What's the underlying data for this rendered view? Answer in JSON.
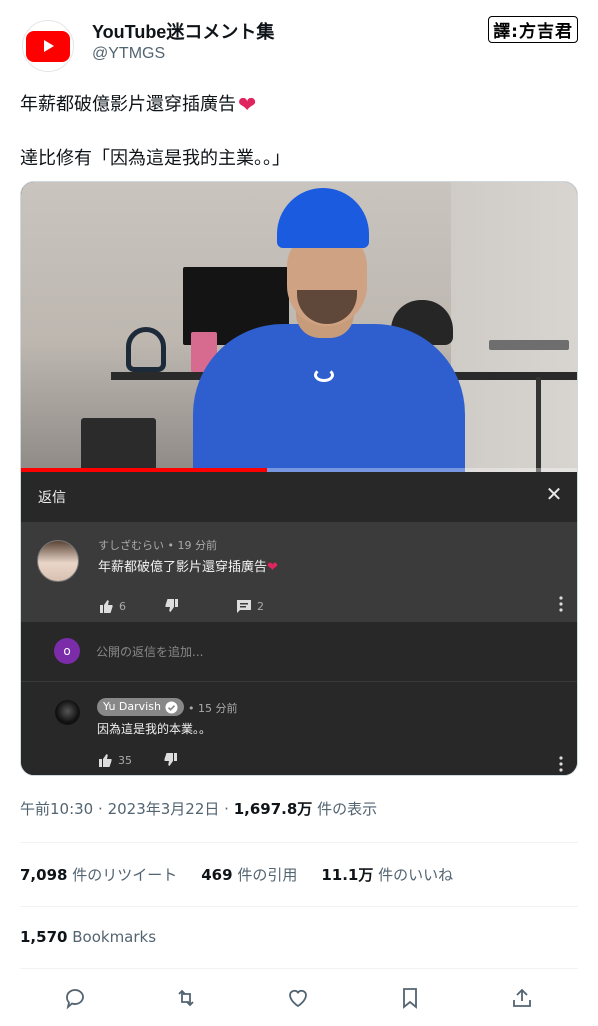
{
  "account": {
    "name": "YouTube迷コメント集",
    "handle": "@YTMGS",
    "avatar_icon": "youtube-logo-icon"
  },
  "stamp": "譯:方吉君",
  "tweet": {
    "line1": "年薪都破億影片還穿插廣告",
    "line2": "達比修有「因為這是我的主業。。」"
  },
  "video": {
    "progress_fraction": 0.44
  },
  "panel": {
    "title": "返信"
  },
  "comment": {
    "author": "すしざむらい",
    "time": "19 分前",
    "text": "年薪都破億了影片還穿插廣告",
    "likes": "6",
    "replies": "2"
  },
  "reply_input": {
    "avatar_letter": "o",
    "placeholder": "公開の返信を追加..."
  },
  "reply": {
    "author": "Yu Darvish",
    "time": "15 分前",
    "text": "因為這是我的本業。。",
    "likes": "35"
  },
  "meta": {
    "time": "午前10:30",
    "date": "2023年3月22日",
    "views": "1,697.8万",
    "views_label": "件の表示"
  },
  "stats": {
    "retweets": "7,098",
    "retweets_label": "件のリツイート",
    "quotes": "469",
    "quotes_label": "件の引用",
    "likes": "11.1万",
    "likes_label": "件のいいね"
  },
  "bookmarks": {
    "count": "1,570",
    "label": "Bookmarks"
  },
  "colors": {
    "heart": "#e0245e",
    "youtube_red": "#ff0000",
    "verified_badge": "#888888"
  }
}
